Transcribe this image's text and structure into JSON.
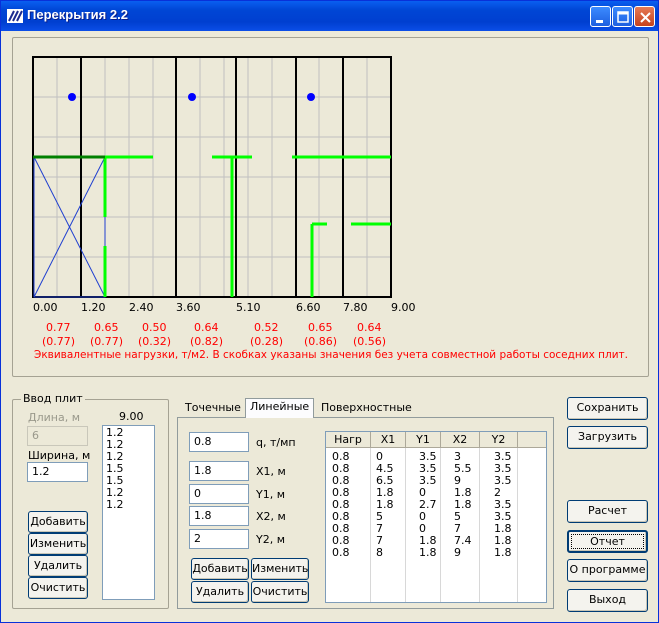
{
  "window": {
    "title": "Перекрытия 2.2"
  },
  "plan": {
    "x_labels": [
      "0.00",
      "1.20",
      "2.40",
      "3.60",
      "5.10",
      "6.60",
      "7.80",
      "9.00"
    ],
    "loads_top": [
      "0.77",
      "0.65",
      "0.50",
      "0.64",
      "0.52",
      "0.65",
      "0.64"
    ],
    "loads_bottom": [
      "(0.77)",
      "(0.77)",
      "(0.32)",
      "(0.82)",
      "(0.28)",
      "(0.86)",
      "(0.56)"
    ],
    "note": "Эквивалентные нагрузки, т/м2. В скобках указаны значения без учета совместной работы соседних плит."
  },
  "slabs": {
    "group_title": "Ввод плит",
    "length_label": "Длина, м",
    "length_value": "6",
    "width_label": "Ширина, м",
    "width_value": "1.2",
    "total": "9.00",
    "list": [
      "1.2",
      "1.2",
      "1.2",
      "1.5",
      "1.5",
      "1.2",
      "1.2"
    ],
    "add": "Добавить",
    "edit": "Изменить",
    "delete": "Удалить",
    "clear": "Очистить"
  },
  "loads": {
    "tabs": [
      "Точечные",
      "Линейные",
      "Поверхностные"
    ],
    "q_value": "0.8",
    "q_label": "q, т/мп",
    "x1_value": "1.8",
    "x1_label": "X1, м",
    "y1_value": "0",
    "y1_label": "Y1, м",
    "x2_value": "1.8",
    "x2_label": "X2, м",
    "y2_value": "2",
    "y2_label": "Y2, м",
    "add": "Добавить",
    "edit": "Изменить",
    "delete": "Удалить",
    "clear": "Очистить",
    "columns": [
      "Нагр",
      "X1",
      "Y1",
      "X2",
      "Y2"
    ],
    "rows": [
      [
        "0.8",
        "0",
        "3.5",
        "3",
        "3.5"
      ],
      [
        "0.8",
        "4.5",
        "3.5",
        "5.5",
        "3.5"
      ],
      [
        "0.8",
        "6.5",
        "3.5",
        "9",
        "3.5"
      ],
      [
        "0.8",
        "1.8",
        "0",
        "1.8",
        "2"
      ],
      [
        "0.8",
        "1.8",
        "2.7",
        "1.8",
        "3.5"
      ],
      [
        "0.8",
        "5",
        "0",
        "5",
        "3.5"
      ],
      [
        "0.8",
        "7",
        "0",
        "7",
        "1.8"
      ],
      [
        "0.8",
        "7",
        "1.8",
        "7.4",
        "1.8"
      ],
      [
        "0.8",
        "8",
        "1.8",
        "9",
        "1.8"
      ]
    ]
  },
  "actions": {
    "save": "Сохранить",
    "load": "Загрузить",
    "calc": "Расчет",
    "report": "Отчет",
    "about": "О программе",
    "exit": "Выход"
  }
}
